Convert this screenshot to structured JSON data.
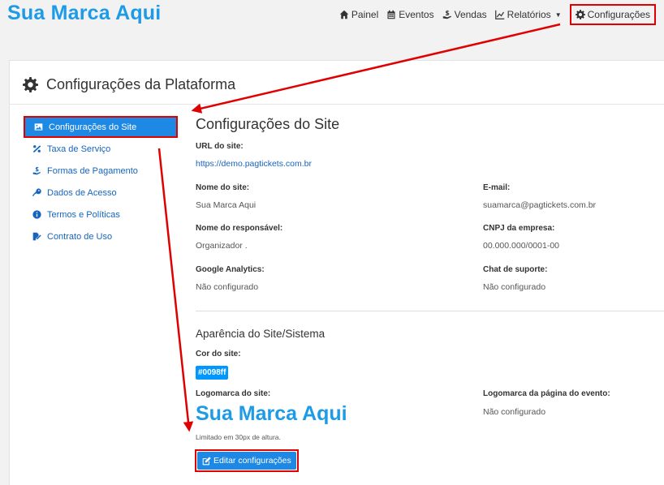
{
  "brand": "Sua Marca Aqui",
  "nav": {
    "painel": "Painel",
    "eventos": "Eventos",
    "vendas": "Vendas",
    "relatorios": "Relatórios",
    "configuracoes": "Configurações"
  },
  "page": {
    "title": "Configurações da Plataforma"
  },
  "sidebar": {
    "items": [
      {
        "label": "Configurações do Site",
        "icon": "image-icon"
      },
      {
        "label": "Taxa de Serviço",
        "icon": "percent-icon"
      },
      {
        "label": "Formas de Pagamento",
        "icon": "hand-holding-dollar-icon"
      },
      {
        "label": "Dados de Acesso",
        "icon": "key-icon"
      },
      {
        "label": "Termos e Políticas",
        "icon": "info-circle-icon"
      },
      {
        "label": "Contrato de Uso",
        "icon": "file-signature-icon"
      }
    ]
  },
  "site": {
    "title": "Configurações do Site",
    "url_label": "URL do site:",
    "url_value": "https://demo.pagtickets.com.br",
    "name_label": "Nome do site:",
    "name_value": "Sua Marca Aqui",
    "email_label": "E-mail:",
    "email_value": "suamarca@pagtickets.com.br",
    "responsible_label": "Nome do responsável:",
    "responsible_value": "Organizador .",
    "cnpj_label": "CNPJ da empresa:",
    "cnpj_value": "00.000.000/0001-00",
    "analytics_label": "Google Analytics:",
    "analytics_value": "Não configurado",
    "chat_label": "Chat de suporte:",
    "chat_value": "Não configurado"
  },
  "appearance": {
    "title": "Aparência do Site/Sistema",
    "color_label": "Cor do site:",
    "color_value": "#0098ff",
    "logo_label": "Logomarca do site:",
    "logo_text": "Sua Marca Aqui",
    "logo_note": "Limitado em 30px de altura.",
    "event_logo_label": "Logomarca da página do evento:",
    "event_logo_value": "Não configurado",
    "edit_button": "Editar configurações"
  },
  "colors": {
    "brand": "#1e9be6",
    "primary": "#1e88e5",
    "link": "#1565c0",
    "highlight": "#e00000"
  }
}
